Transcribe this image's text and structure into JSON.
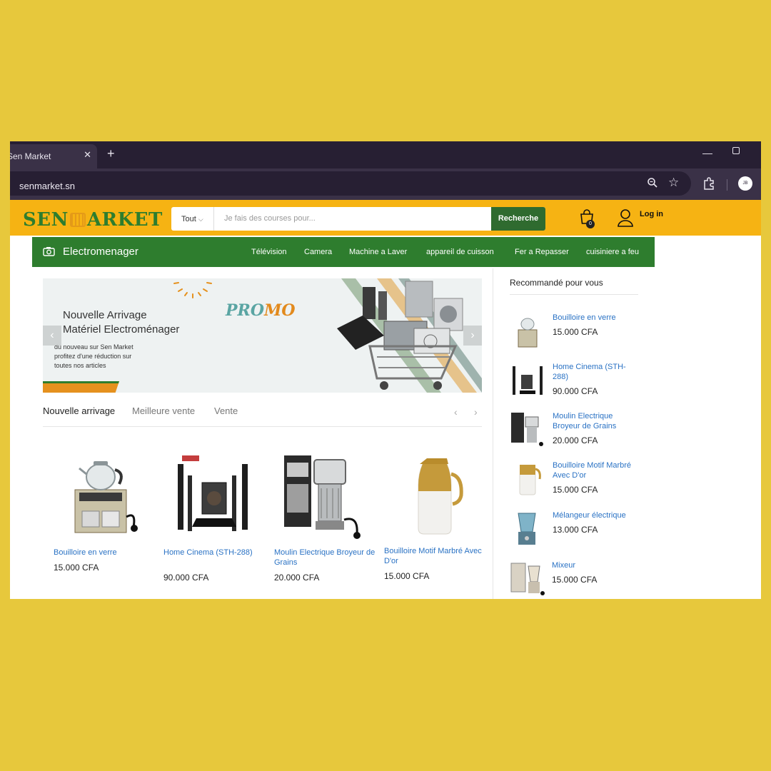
{
  "browser": {
    "tab_title": "Sen Market",
    "close_symbol": "✕",
    "new_tab_symbol": "+",
    "url": "senmarket.sn"
  },
  "header": {
    "logo_left": "SEN",
    "logo_right": "ARKET",
    "search_category": "Tout",
    "search_placeholder": "Je fais des courses pour...",
    "search_button": "Recherche",
    "cart_count": "0",
    "login": "Log in"
  },
  "category_nav": {
    "title": "Electromenager",
    "links": [
      "Télévision",
      "Camera",
      "Machine a Laver",
      "appareil de cuisson",
      "Fer a Repasser",
      "cuisiniere a feu"
    ]
  },
  "banner": {
    "heading_line1": "Nouvelle Arrivage",
    "heading_line2": "Matériel Electroménager",
    "text_line1": "du nouveau sur Sen Market",
    "text_line2": "profitez d'une réduction sur",
    "text_line3": "toutes nos articles",
    "promo_a": "PRO",
    "promo_b": "MO"
  },
  "product_tabs": [
    "Nouvelle arrivage",
    "Meilleure vente",
    "Vente"
  ],
  "products": [
    {
      "name": "Bouilloire en verre",
      "price": "15.000 CFA",
      "icon": "kettle-icon"
    },
    {
      "name": "Home Cinema (STH-288)",
      "price": "90.000 CFA",
      "icon": "home-cinema-icon"
    },
    {
      "name": "Moulin Electrique Broyeur de Grains",
      "price": "20.000 CFA",
      "icon": "grinder-icon"
    },
    {
      "name": "Bouilloire Motif Marbré Avec D'or",
      "price": "15.000 CFA",
      "icon": "thermos-icon"
    }
  ],
  "sidebar": {
    "title": "Recommandé pour vous",
    "items": [
      {
        "name": "Bouilloire en verre",
        "price": "15.000 CFA"
      },
      {
        "name": "Home Cinema (STH-288)",
        "price": "90.000 CFA"
      },
      {
        "name": "Moulin Electrique Broyeur de Grains",
        "price": "20.000 CFA"
      },
      {
        "name": "Bouilloire Motif Marbré Avec D'or",
        "price": "15.000 CFA"
      },
      {
        "name": "Mélangeur électrique",
        "price": "13.000 CFA"
      },
      {
        "name": "Mixeur",
        "price": "15.000 CFA"
      }
    ]
  },
  "colors": {
    "background": "#e7c83c",
    "header_yellow": "#f6b313",
    "brand_green": "#2e7d2e",
    "link_blue": "#2a72c4"
  }
}
